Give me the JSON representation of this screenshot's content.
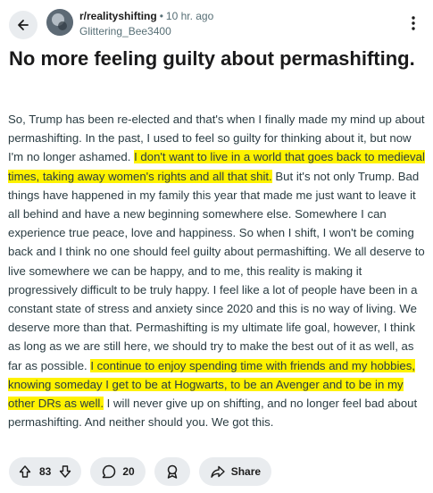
{
  "post": {
    "subreddit": "r/realityshifting",
    "separator": "•",
    "time": "10 hr. ago",
    "author": "Glittering_Bee3400",
    "title": "No more feeling guilty about permashifting.",
    "body": {
      "p1": "So, Trump has been re-elected and that's when I finally made my mind up about permashifting. In the past, I used to feel so guilty for thinking about it, but now I'm no longer ashamed. ",
      "h1": "I don't want to live in a world that goes back to medieval times, taking away women's rights and all that shit.",
      "p2": " But it's not only Trump. Bad things have happened in my family this year that made me just want to leave it all behind and have a new beginning somewhere else. Somewhere I can experience true peace, love and happiness. So when I shift, I won't be coming back and I think no one should feel guilty about permashifting. We all deserve to live somewhere we can be happy, and to me, this reality is making it progressively difficult to be truly happy. I feel like a lot of people have been in a constant state of stress and anxiety since 2020 and this is no way of living. We deserve more than that. Permashifting is my ultimate life goal, however, I think as long as we are still here, we should try to make the best out of it as well, as far as possible. ",
      "h2": "I continue to enjoy spending time with friends and my hobbies, knowing someday I get to be at Hogwarts, to be an Avenger and to be in my other DRs as well.",
      "p3": " I will never give up on shifting, and no longer feel bad about permashifting. And neither should you. We got this."
    },
    "highlight_color": "#fff200"
  },
  "actions": {
    "upvotes": "83",
    "comments": "20",
    "share_label": "Share"
  },
  "icons": {
    "back": "back-arrow-icon",
    "more": "more-dots-icon",
    "upvote": "upvote-arrow-icon",
    "downvote": "downvote-arrow-icon",
    "comment": "comment-bubble-icon",
    "award": "award-icon",
    "share": "share-arrow-icon"
  }
}
